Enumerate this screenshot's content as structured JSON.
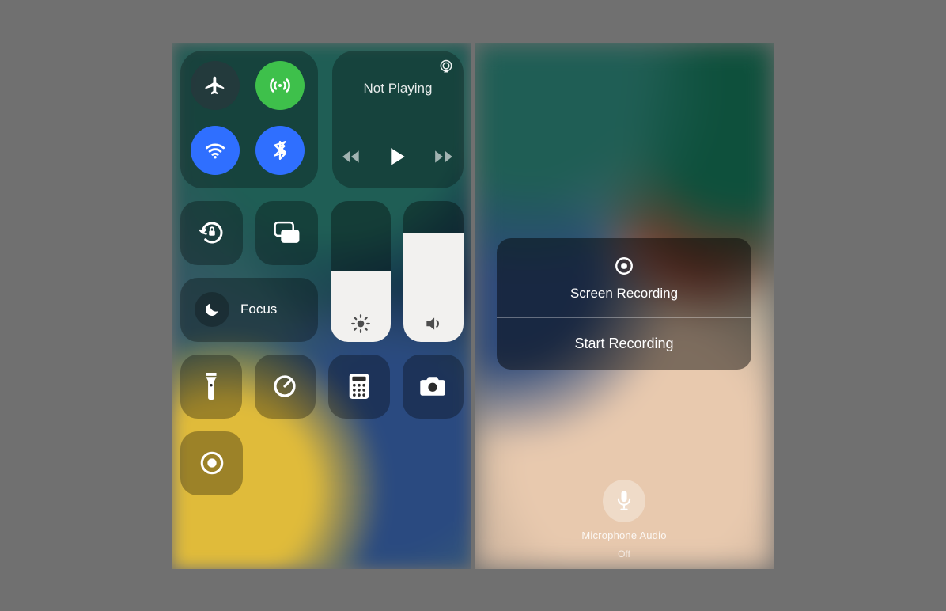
{
  "left": {
    "media": {
      "status": "Not Playing"
    },
    "focus": {
      "label": "Focus"
    },
    "brightness_pct": 50,
    "volume_pct": 77
  },
  "right": {
    "sheet": {
      "title": "Screen Recording",
      "action": "Start Recording"
    },
    "mic": {
      "label": "Microphone Audio",
      "state": "Off"
    }
  },
  "icons": {
    "airplane": "airplane-icon",
    "cellular": "cellular-icon",
    "wifi": "wifi-icon",
    "bluetooth": "bluetooth-icon",
    "airplay": "airplay-icon",
    "rewind": "rewind-icon",
    "play": "play-icon",
    "forward": "forward-icon",
    "orientation_lock": "orientation-lock-icon",
    "screen_mirroring": "screen-mirroring-icon",
    "moon": "moon-icon",
    "brightness": "brightness-icon",
    "volume": "volume-icon",
    "flashlight": "flashlight-icon",
    "timer": "timer-icon",
    "calculator": "calculator-icon",
    "camera": "camera-icon",
    "record": "record-icon",
    "microphone": "microphone-icon"
  }
}
